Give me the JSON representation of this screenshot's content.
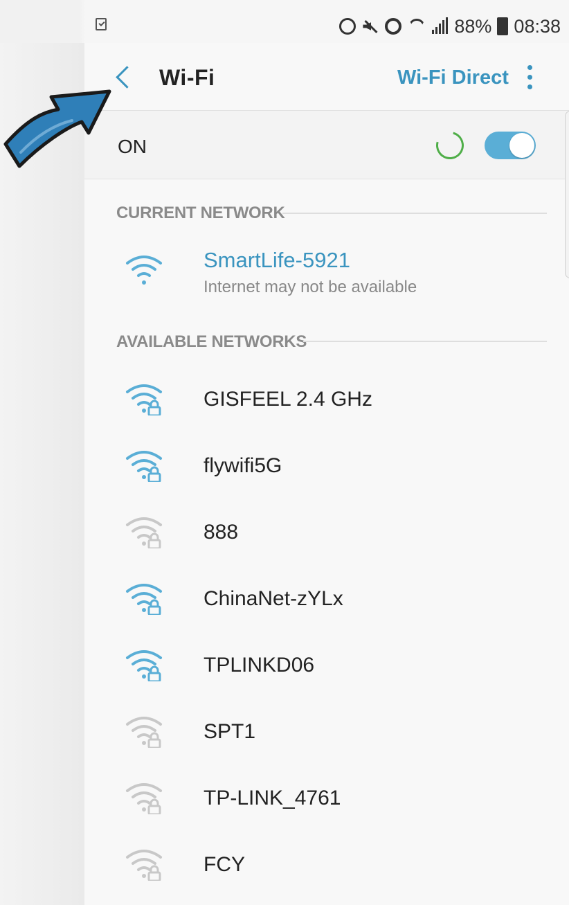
{
  "status_bar": {
    "battery": "88%",
    "time": "08:38",
    "icons": [
      "sync-alert-icon",
      "mute-icon",
      "alarm-icon",
      "wifi-icon",
      "signal-icon",
      "battery-icon"
    ],
    "left_icon": "checklist-notification-icon"
  },
  "header": {
    "title": "Wi-Fi",
    "wifi_direct": "Wi-Fi Direct",
    "back_icon": "back-chevron-icon",
    "more_icon": "more-vertical-icon"
  },
  "toggle_row": {
    "label": "ON",
    "enabled": true
  },
  "current_network": {
    "section_title": "CURRENT NETWORK",
    "name": "SmartLife-5921",
    "status": "Internet may not be available",
    "icon": "wifi-open-icon"
  },
  "available_networks": {
    "section_title": "AVAILABLE NETWORKS",
    "items": [
      {
        "name": "GISFEEL 2.4 GHz",
        "locked": true,
        "strength": "strong"
      },
      {
        "name": "flywifi5G",
        "locked": true,
        "strength": "strong"
      },
      {
        "name": "888",
        "locked": true,
        "strength": "weak"
      },
      {
        "name": "ChinaNet-zYLx",
        "locked": true,
        "strength": "strong"
      },
      {
        "name": "TPLINKD06",
        "locked": true,
        "strength": "strong"
      },
      {
        "name": "SPT1",
        "locked": true,
        "strength": "weak"
      },
      {
        "name": "TP-LINK_4761",
        "locked": true,
        "strength": "weak"
      },
      {
        "name": "FCY",
        "locked": true,
        "strength": "weak"
      }
    ]
  },
  "colors": {
    "accent": "#3a94bf",
    "wifi_strong": "#5aaed6",
    "wifi_weak": "#c8c8c8",
    "annotation_arrow": "#2f7fb8"
  }
}
